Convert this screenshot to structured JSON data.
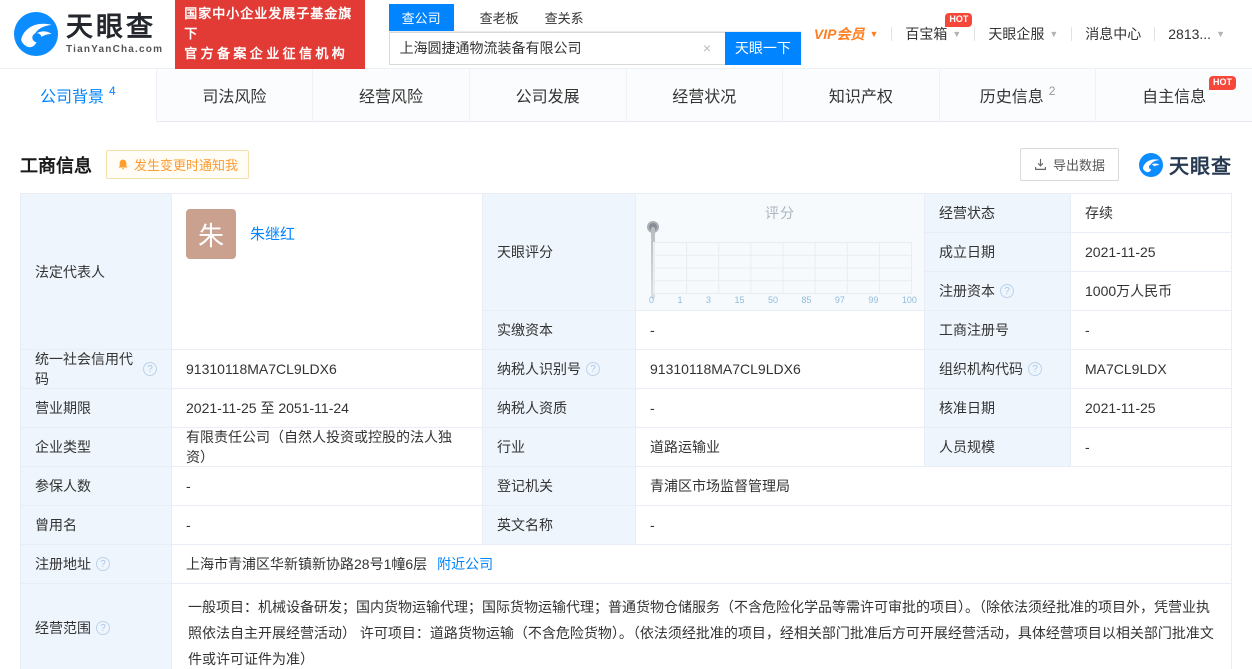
{
  "brand": {
    "name": "天眼查",
    "domain": "TianYanCha.com",
    "badge_line1": "国家中小企业发展子基金旗下",
    "badge_line2": "官方备案企业征信机构",
    "accent_blue": "#0084ff",
    "badge_red": "#e23a34"
  },
  "search": {
    "tab_company": "查公司",
    "tab_boss": "查老板",
    "tab_relation": "查关系",
    "value": "上海圆捷通物流装备有限公司",
    "clear": "×",
    "button": "天眼一下"
  },
  "menu": {
    "vip": "VIP会员",
    "treasure": "百宝箱",
    "qifu": "天眼企服",
    "message": "消息中心",
    "user": "2813...",
    "hot": "HOT"
  },
  "nav": {
    "tabs": [
      {
        "label": "公司背景",
        "count": "4"
      },
      {
        "label": "司法风险"
      },
      {
        "label": "经营风险"
      },
      {
        "label": "公司发展"
      },
      {
        "label": "经营状况"
      },
      {
        "label": "知识产权"
      },
      {
        "label": "历史信息",
        "count": "2"
      },
      {
        "label": "自主信息",
        "hot": "HOT"
      }
    ]
  },
  "section": {
    "title": "工商信息",
    "notify": "发生变更时通知我",
    "export": "导出数据",
    "logo_text": "天眼查"
  },
  "info": {
    "legal_rep_label": "法定代表人",
    "avatar_text": "朱",
    "legal_rep_name": "朱继红",
    "status_label": "经营状态",
    "status": "存续",
    "est_date_label": "成立日期",
    "est_date": "2021-11-25",
    "reg_capital_label": "注册资本",
    "reg_capital": "1000万人民币",
    "paid_capital_label": "实缴资本",
    "paid_capital": "-",
    "score_label": "天眼评分",
    "score_title": "评分",
    "score_ticks": [
      "0",
      "1",
      "3",
      "15",
      "50",
      "85",
      "97",
      "99",
      "100"
    ],
    "reg_no_label": "工商注册号",
    "reg_no": "-",
    "credit_code_label": "统一社会信用代码",
    "credit_code": "91310118MA7CL9LDX6",
    "taxpayer_id_label": "纳税人识别号",
    "taxpayer_id": "91310118MA7CL9LDX6",
    "org_code_label": "组织机构代码",
    "org_code": "MA7CL9LDX",
    "biz_term_label": "营业期限",
    "biz_term": "2021-11-25 至 2051-11-24",
    "taxpayer_quality_label": "纳税人资质",
    "taxpayer_quality": "-",
    "approval_date_label": "核准日期",
    "approval_date": "2021-11-25",
    "company_type_label": "企业类型",
    "company_type": "有限责任公司（自然人投资或控股的法人独资）",
    "industry_label": "行业",
    "industry": "道路运输业",
    "staff_size_label": "人员规模",
    "staff_size": "-",
    "insured_label": "参保人数",
    "insured": "-",
    "registry_label": "登记机关",
    "registry": "青浦区市场监督管理局",
    "former_name_label": "曾用名",
    "former_name": "-",
    "english_name_label": "英文名称",
    "english_name": "-",
    "address_label": "注册地址",
    "address": "上海市青浦区华新镇新协路28号1幢6层",
    "nearby_link": "附近公司",
    "scope_label": "经营范围",
    "scope": "一般项目：机械设备研发；国内货物运输代理；国际货物运输代理；普通货物仓储服务（不含危险化学品等需许可审批的项目）。（除依法须经批准的项目外，凭营业执照依法自主开展经营活动） 许可项目：道路货物运输（不含危险货物）。（依法须经批准的项目，经相关部门批准后方可开展经营活动，具体经营项目以相关部门批准文件或许可证件为准）"
  }
}
